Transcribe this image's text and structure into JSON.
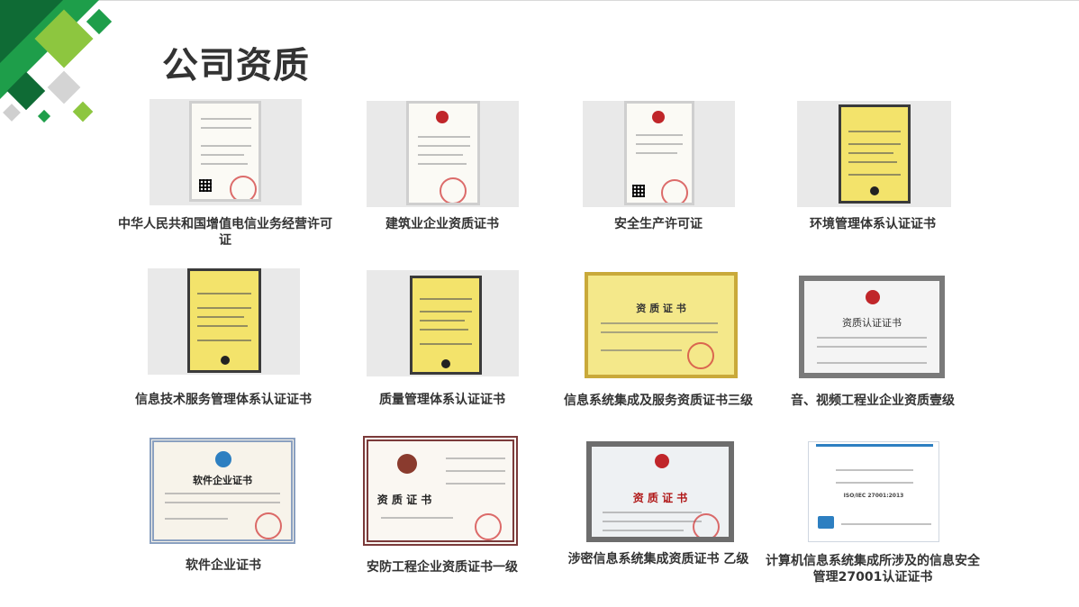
{
  "page": {
    "title": "公司资质"
  },
  "certificates": [
    {
      "caption": "中华人民共和国增值电信业务经营许可证",
      "style": "white"
    },
    {
      "caption": "建筑业企业资质证书",
      "style": "white"
    },
    {
      "caption": "安全生产许可证",
      "style": "white"
    },
    {
      "caption": "环境管理体系认证证书",
      "style": "yellow"
    },
    {
      "caption": "信息技术服务管理体系认证证书",
      "style": "yellow"
    },
    {
      "caption": "质量管理体系认证证书",
      "style": "yellow"
    },
    {
      "caption": "信息系统集成及服务资质证书三级",
      "style": "yellow-ornate",
      "inner": "资 质 证 书"
    },
    {
      "caption": "音、视频工程业企业资质壹级",
      "style": "framed-gray",
      "inner": "资质认证证书"
    },
    {
      "caption": "软件企业证书",
      "style": "framed-blue",
      "inner": "软件企业证书"
    },
    {
      "caption": "安防工程企业资质证书一级",
      "style": "framed-red",
      "inner": "资 质 证 书"
    },
    {
      "caption": "涉密信息系统集成资质证书 乙级",
      "style": "framed-gray",
      "inner": "资 质 证 书"
    },
    {
      "caption": "计算机信息系统集成所涉及的信息安全管理27001认证证书",
      "style": "plain",
      "inner": "ISO/IEC 27001:2013"
    }
  ],
  "colors": {
    "accent_green": "#1e9e4a",
    "light_green": "#8dc63f",
    "dark_green": "#0f6b35"
  }
}
